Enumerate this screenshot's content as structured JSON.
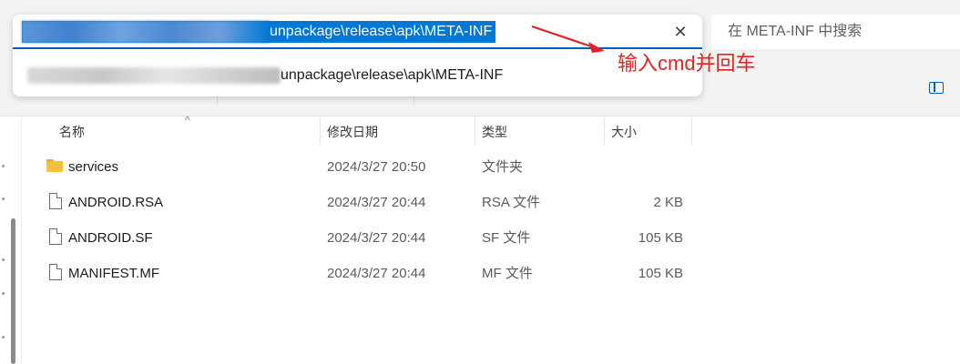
{
  "address_bar": {
    "path_tail": "unpackage\\release\\apk\\META-INF",
    "clear_icon": "close-icon",
    "suggestion_tail": "unpackage\\release\\apk\\META-INF"
  },
  "search": {
    "placeholder": "在 META-INF 中搜索"
  },
  "annotation": {
    "text": "输入cmd并回车",
    "color": "#e32222"
  },
  "columns": {
    "name": "名称",
    "date": "修改日期",
    "type": "类型",
    "size": "大小"
  },
  "files": [
    {
      "name": "services",
      "date": "2024/3/27 20:50",
      "type": "文件夹",
      "size": "",
      "icon": "folder-icon"
    },
    {
      "name": "ANDROID.RSA",
      "date": "2024/3/27 20:44",
      "type": "RSA 文件",
      "size": "2 KB",
      "icon": "file-icon"
    },
    {
      "name": "ANDROID.SF",
      "date": "2024/3/27 20:44",
      "type": "SF 文件",
      "size": "105 KB",
      "icon": "file-icon"
    },
    {
      "name": "MANIFEST.MF",
      "date": "2024/3/27 20:44",
      "type": "MF 文件",
      "size": "105 KB",
      "icon": "file-icon"
    }
  ],
  "colors": {
    "accent": "#005fb8",
    "selection": "#0078d4",
    "folder": "#f5c040"
  }
}
